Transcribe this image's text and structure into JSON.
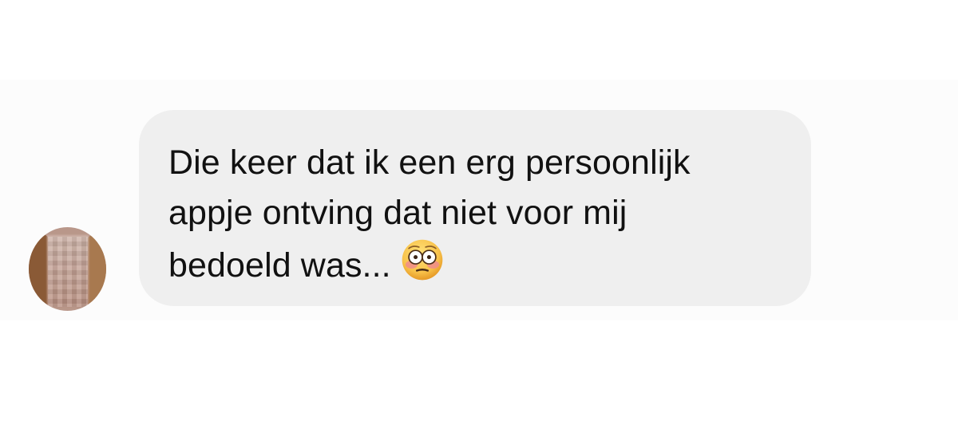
{
  "conversation": {
    "message": {
      "text": "Die keer dat ik een erg persoonlijk\nappje ontving dat niet voor mij\nbedoeld was...",
      "emoji_name": "flushed-face-icon"
    }
  },
  "colors": {
    "background": "#ffffff",
    "band": "#fcfcfc",
    "bubble": "#efefef",
    "text": "#111111",
    "emoji_face": "#f8c24a",
    "emoji_cheeks": "#f08c8b"
  }
}
